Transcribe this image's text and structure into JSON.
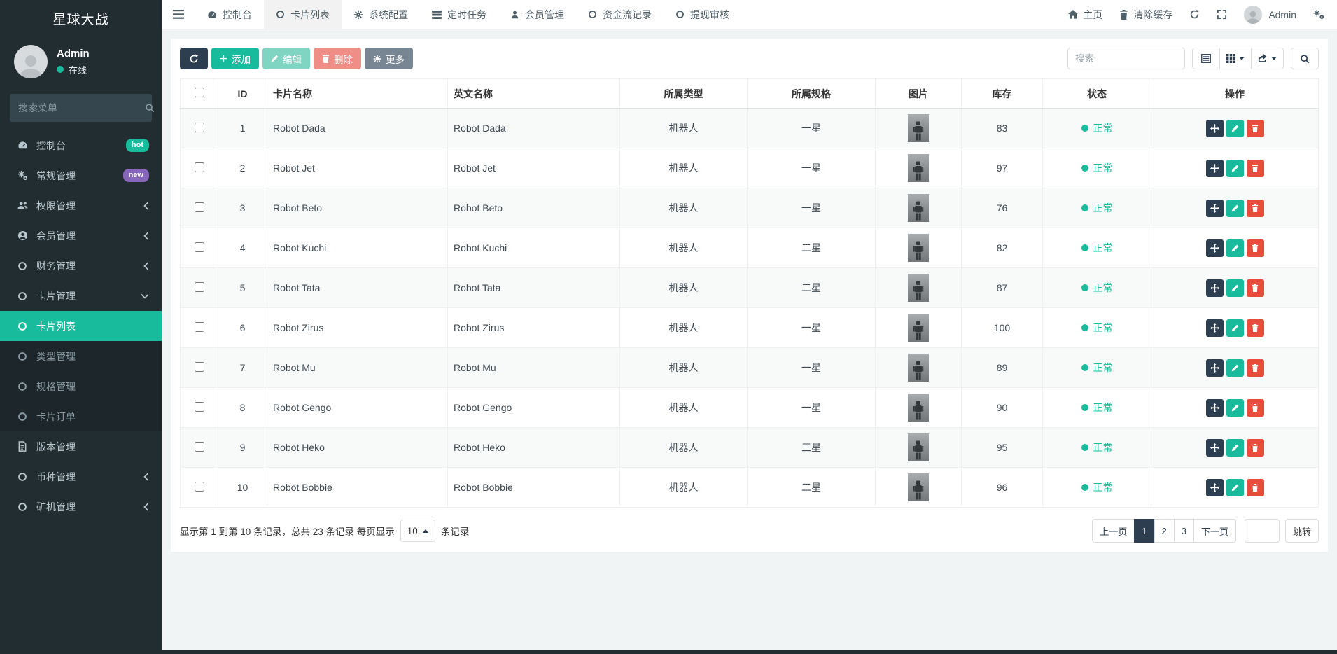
{
  "app": {
    "title": "星球大战"
  },
  "colors": {
    "accent_teal": "#18bc9c",
    "primary_dark": "#2c3e50",
    "danger_red": "#e74c3c",
    "badge_hot": "#18bc9c",
    "badge_new": "#8666b8",
    "sidebar_bg": "#222d32"
  },
  "sidebar": {
    "user": {
      "name": "Admin",
      "status": "在线"
    },
    "search_placeholder": "搜索菜单",
    "menu": [
      {
        "label": "控制台",
        "icon": "tachometer-icon",
        "badge": "hot"
      },
      {
        "label": "常规管理",
        "icon": "gears-icon",
        "badge": "new"
      },
      {
        "label": "权限管理",
        "icon": "users-icon",
        "chevron": "left"
      },
      {
        "label": "会员管理",
        "icon": "user-circle-icon",
        "chevron": "left"
      },
      {
        "label": "财务管理",
        "icon": "circle-icon",
        "chevron": "left"
      },
      {
        "label": "卡片管理",
        "icon": "circle-icon",
        "chevron": "down"
      },
      {
        "label": "卡片列表",
        "icon": "circle-icon",
        "submenu": true,
        "active": true
      },
      {
        "label": "类型管理",
        "icon": "circle-icon",
        "submenu": true
      },
      {
        "label": "规格管理",
        "icon": "circle-icon",
        "submenu": true
      },
      {
        "label": "卡片订单",
        "icon": "circle-icon",
        "submenu": true
      },
      {
        "label": "版本管理",
        "icon": "file-icon"
      },
      {
        "label": "币种管理",
        "icon": "circle-icon",
        "chevron": "left"
      },
      {
        "label": "矿机管理",
        "icon": "circle-icon",
        "chevron": "left"
      }
    ]
  },
  "topbar": {
    "tabs": [
      {
        "label": "控制台",
        "icon": "tachometer-icon"
      },
      {
        "label": "卡片列表",
        "icon": "circle-icon",
        "active": true
      },
      {
        "label": "系统配置",
        "icon": "gear-icon"
      },
      {
        "label": "定时任务",
        "icon": "tasks-icon"
      },
      {
        "label": "会员管理",
        "icon": "user-icon"
      },
      {
        "label": "资金流记录",
        "icon": "circle-icon"
      },
      {
        "label": "提现审核",
        "icon": "circle-icon"
      }
    ],
    "home_label": "主页",
    "clear_cache_label": "清除缓存",
    "username": "Admin"
  },
  "toolbar": {
    "add_label": "添加",
    "edit_label": "编辑",
    "delete_label": "删除",
    "more_label": "更多",
    "search_placeholder": "搜索"
  },
  "table": {
    "columns": [
      "ID",
      "卡片名称",
      "英文名称",
      "所属类型",
      "所属规格",
      "图片",
      "库存",
      "状态",
      "操作"
    ],
    "rows": [
      {
        "id": "1",
        "name": "Robot Dada",
        "en": "Robot Dada",
        "type": "机器人",
        "spec": "一星",
        "stock": "83",
        "status": "正常"
      },
      {
        "id": "2",
        "name": "Robot Jet",
        "en": "Robot Jet",
        "type": "机器人",
        "spec": "一星",
        "stock": "97",
        "status": "正常"
      },
      {
        "id": "3",
        "name": "Robot Beto",
        "en": "Robot Beto",
        "type": "机器人",
        "spec": "一星",
        "stock": "76",
        "status": "正常"
      },
      {
        "id": "4",
        "name": "Robot Kuchi",
        "en": "Robot Kuchi",
        "type": "机器人",
        "spec": "二星",
        "stock": "82",
        "status": "正常"
      },
      {
        "id": "5",
        "name": "Robot Tata",
        "en": "Robot Tata",
        "type": "机器人",
        "spec": "二星",
        "stock": "87",
        "status": "正常"
      },
      {
        "id": "6",
        "name": "Robot Zirus",
        "en": "Robot Zirus",
        "type": "机器人",
        "spec": "一星",
        "stock": "100",
        "status": "正常"
      },
      {
        "id": "7",
        "name": "Robot Mu",
        "en": "Robot Mu",
        "type": "机器人",
        "spec": "一星",
        "stock": "89",
        "status": "正常"
      },
      {
        "id": "8",
        "name": "Robot Gengo",
        "en": "Robot Gengo",
        "type": "机器人",
        "spec": "一星",
        "stock": "90",
        "status": "正常"
      },
      {
        "id": "9",
        "name": "Robot Heko",
        "en": "Robot Heko",
        "type": "机器人",
        "spec": "三星",
        "stock": "95",
        "status": "正常"
      },
      {
        "id": "10",
        "name": "Robot Bobbie",
        "en": "Robot Bobbie",
        "type": "机器人",
        "spec": "二星",
        "stock": "96",
        "status": "正常"
      }
    ]
  },
  "pagination": {
    "info": "显示第 1 到第 10 条记录，总共 23 条记录 每页显示",
    "page_size": "10",
    "info_suffix": "条记录",
    "prev_label": "上一页",
    "pages": [
      "1",
      "2",
      "3"
    ],
    "active_page": "1",
    "next_label": "下一页",
    "jump_label": "跳转"
  }
}
